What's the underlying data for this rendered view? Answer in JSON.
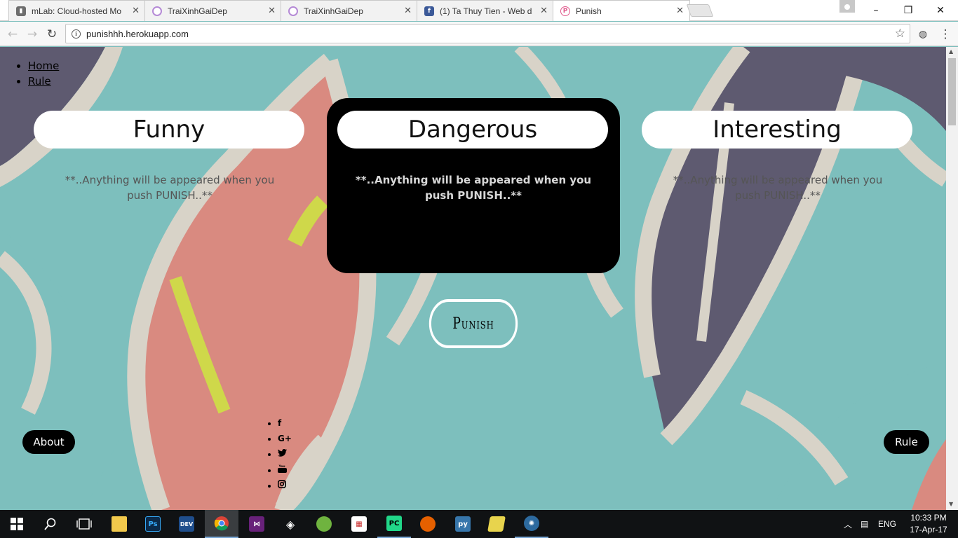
{
  "browser": {
    "tabs": [
      {
        "title": "mLab: Cloud-hosted Mo",
        "favicon_color": "#6d6d6d",
        "favicon_glyph": "m",
        "active": false
      },
      {
        "title": "TraiXinhGaiDep",
        "favicon_color": "#b58ad6",
        "favicon_glyph": "",
        "active": false
      },
      {
        "title": "TraiXinhGaiDep",
        "favicon_color": "#b58ad6",
        "favicon_glyph": "",
        "active": false
      },
      {
        "title": "(1) Ta Thuy Tien - Web d",
        "favicon_color": "#3b5998",
        "favicon_glyph": "f",
        "active": false
      },
      {
        "title": "Punish",
        "favicon_color": "#e05a8c",
        "favicon_glyph": "P",
        "active": true
      }
    ],
    "url": "punishhh.herokuapp.com",
    "window_controls": {
      "minimize": "–",
      "restore": "❐",
      "close": "✕"
    }
  },
  "page": {
    "nav": [
      {
        "label": "Home"
      },
      {
        "label": "Rule"
      }
    ],
    "cards": [
      {
        "title": "Funny",
        "message": "**..Anything will be appeared when you push PUNISH..**",
        "highlighted": false
      },
      {
        "title": "Dangerous",
        "message": "**..Anything will be appeared when you push PUNISH..**",
        "highlighted": true
      },
      {
        "title": "Interesting",
        "message": "**..Anything will be appeared when you push PUNISH..**",
        "highlighted": false
      }
    ],
    "punish_label": "Punish",
    "about_label": "About",
    "rule_label": "Rule",
    "social_icons": [
      "facebook-icon",
      "google-plus-icon",
      "twitter-icon",
      "youtube-icon",
      "instagram-icon"
    ],
    "social_glyphs": [
      "f",
      "G+",
      "🐦",
      "▶",
      "◎"
    ]
  },
  "taskbar": {
    "apps": [
      "windows-start-icon",
      "search-icon",
      "task-view-icon",
      "file-explorer-icon",
      "photoshop-icon",
      "devexpress-icon",
      "chrome-icon",
      "visual-studio-icon",
      "unity-icon",
      "android-studio-icon",
      "app-icon",
      "pycharm-icon",
      "firefox-icon",
      "python-icon",
      "folder-icon",
      "app-circle-icon"
    ],
    "language": "ENG",
    "time": "10:33 PM",
    "date": "17-Apr-17"
  },
  "colors": {
    "background_teal": "#7dbfbd",
    "feather_pink": "#d98a80",
    "feather_purple": "#5e5a70",
    "feather_beige": "#d8d3c8",
    "accent_yellow": "#cfd84a"
  }
}
